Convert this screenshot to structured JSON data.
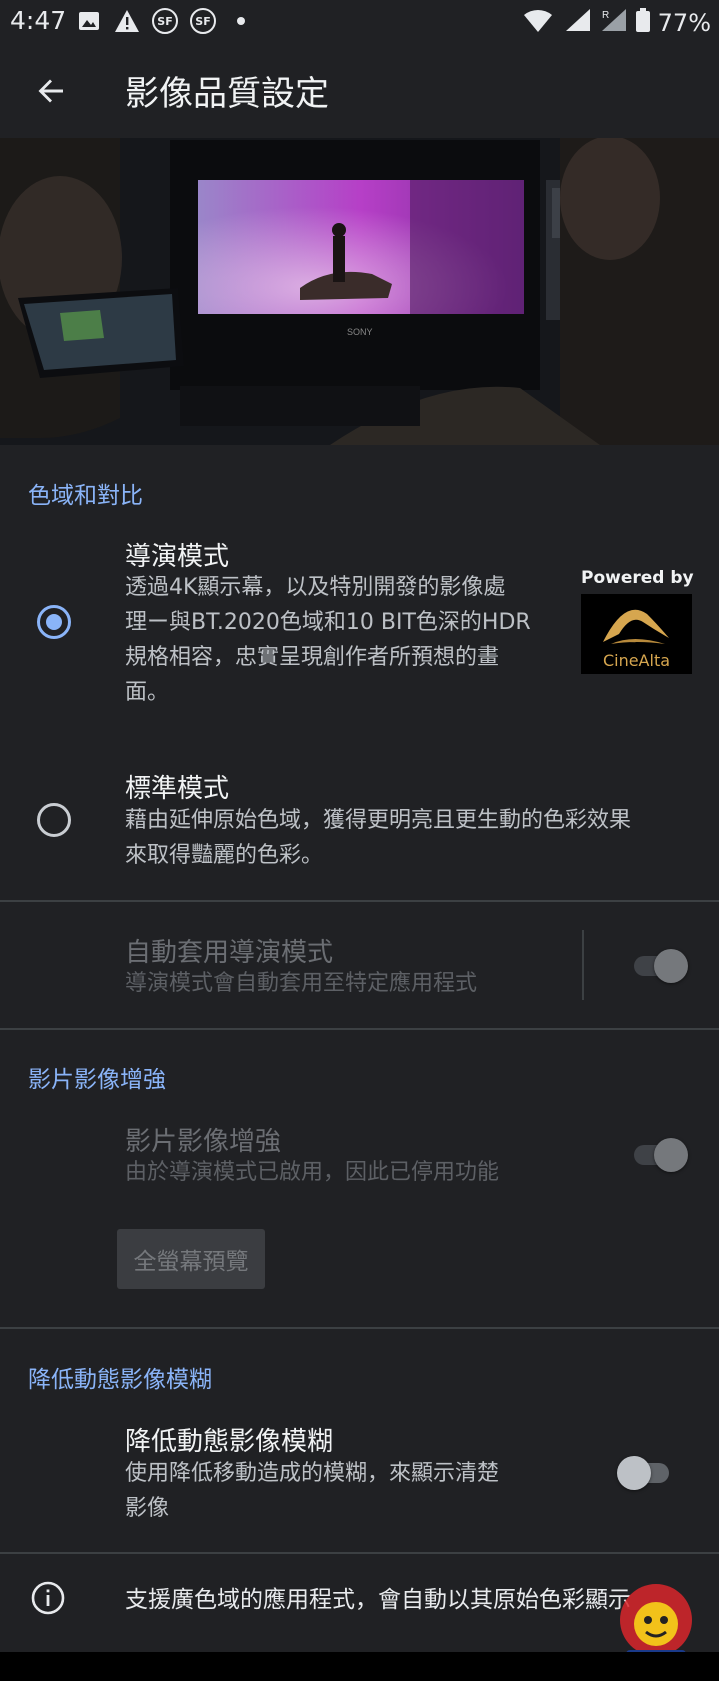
{
  "status_bar": {
    "time": "4:47",
    "battery": "77%",
    "icons_left": [
      "image-icon",
      "alert-icon",
      "sf-icon",
      "sf-icon",
      "dot-icon"
    ],
    "icons_right": [
      "wifi-icon",
      "signal-icon",
      "signal-roaming-icon",
      "battery-icon"
    ]
  },
  "app_bar": {
    "title": "影像品質設定"
  },
  "section_color": {
    "header": "色域和對比",
    "options": [
      {
        "title": "導演模式",
        "summary": [
          "透過4K顯示幕，以及特別開發的影像處",
          "理ー與BT.2020色域和10 BIT色深的HDR",
          "規格相容，忠實呈現創作者所預想的畫",
          "面。"
        ],
        "selected": true
      },
      {
        "title": "標準模式",
        "summary": [
          "藉由延伸原始色域，獲得更明亮且更生動的色彩效果",
          "來取得豔麗的色彩。"
        ],
        "selected": false
      }
    ],
    "badge": {
      "powered_by": "Powered by",
      "brand": "CineAlta"
    }
  },
  "auto_director": {
    "title": "自動套用導演模式",
    "summary": "導演模式會自動套用至特定應用程式",
    "enabled": false,
    "toggle_on": true
  },
  "section_video": {
    "header": "影片影像增強",
    "title": "影片影像增強",
    "summary": "由於導演模式已啟用，因此已停用功能",
    "enabled": false,
    "toggle_on": true,
    "preview_button": "全螢幕預覽"
  },
  "section_motion": {
    "header": "降低動態影像模糊",
    "title": "降低動態影像模糊",
    "summary": [
      "使用降低移動造成的模糊，來顯示清楚",
      "影像"
    ],
    "toggle_on": false
  },
  "info": {
    "text": "支援廣色域的應用程式，會自動以其原始色彩顯示"
  },
  "colors": {
    "background": "#202124",
    "accent": "#8ab4f8",
    "disabled_text": "#6b6e73"
  }
}
